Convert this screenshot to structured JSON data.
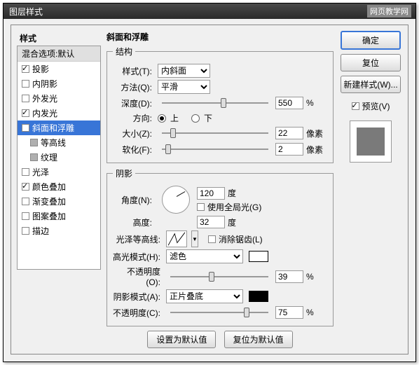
{
  "window": {
    "title": "图层样式",
    "watermark": "网页教学网"
  },
  "leftPanel": {
    "header": "样式",
    "blendHeader": "混合选项:默认",
    "items": [
      {
        "label": "投影",
        "checked": true
      },
      {
        "label": "内阴影",
        "checked": false
      },
      {
        "label": "外发光",
        "checked": false
      },
      {
        "label": "内发光",
        "checked": true
      },
      {
        "label": "斜面和浮雕",
        "checked": true,
        "selected": true
      },
      {
        "label": "等高线",
        "sub": true
      },
      {
        "label": "纹理",
        "sub": true
      },
      {
        "label": "光泽",
        "checked": false
      },
      {
        "label": "颜色叠加",
        "checked": true
      },
      {
        "label": "渐变叠加",
        "checked": false
      },
      {
        "label": "图案叠加",
        "checked": false
      },
      {
        "label": "描边",
        "checked": false
      }
    ]
  },
  "center": {
    "title": "斜面和浮雕",
    "structure": {
      "legend": "结构",
      "styleLabel": "样式(T):",
      "styleValue": "内斜面",
      "techniqueLabel": "方法(Q):",
      "techniqueValue": "平滑",
      "depthLabel": "深度(D):",
      "depthValue": "550",
      "depthUnit": "%",
      "directionLabel": "方向:",
      "upLabel": "上",
      "downLabel": "下",
      "sizeLabel": "大小(Z):",
      "sizeValue": "22",
      "sizeUnit": "像素",
      "softenLabel": "软化(F):",
      "softenValue": "2",
      "softenUnit": "像素"
    },
    "shading": {
      "legend": "阴影",
      "angleLabel": "角度(N):",
      "angleValue": "120",
      "angleUnit": "度",
      "globalLabel": "使用全局光(G)",
      "altitudeLabel": "高度:",
      "altitudeValue": "32",
      "altitudeUnit": "度",
      "glossLabel": "光泽等高线:",
      "antiAliasLabel": "消除锯齿(L)",
      "hlModeLabel": "高光模式(H):",
      "hlModeValue": "滤色",
      "hlColor": "#ffffff",
      "hlOpacityLabel": "不透明度(O):",
      "hlOpacityValue": "39",
      "hlOpacityUnit": "%",
      "shModeLabel": "阴影模式(A):",
      "shModeValue": "正片叠底",
      "shColor": "#000000",
      "shOpacityLabel": "不透明度(C):",
      "shOpacityValue": "75",
      "shOpacityUnit": "%"
    },
    "makeDefault": "设置为默认值",
    "resetDefault": "复位为默认值"
  },
  "right": {
    "ok": "确定",
    "cancel": "复位",
    "newStyle": "新建样式(W)...",
    "previewLabel": "预览(V)"
  }
}
